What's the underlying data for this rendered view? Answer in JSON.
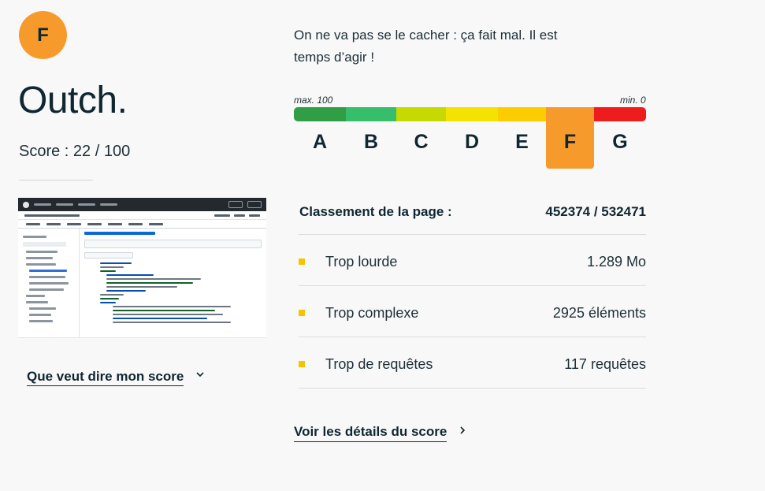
{
  "grade": {
    "letter": "F",
    "color": "#f79a2c"
  },
  "headline": "Outch.",
  "score": {
    "label": "Score : 22 / 100",
    "value": 22,
    "max": 100
  },
  "intro_text": "On ne va pas se le cacher : ça fait mal. Il est temps d’agir !",
  "scale": {
    "max_label": "max. 100",
    "min_label": "min. 0",
    "active": "F",
    "grades": [
      {
        "letter": "A",
        "color": "#2f9e44"
      },
      {
        "letter": "B",
        "color": "#37be6b"
      },
      {
        "letter": "C",
        "color": "#c6d900"
      },
      {
        "letter": "D",
        "color": "#f4e300"
      },
      {
        "letter": "E",
        "color": "#fdcc00"
      },
      {
        "letter": "F",
        "color": "#f79a2c"
      },
      {
        "letter": "G",
        "color": "#ee1c1c"
      }
    ]
  },
  "ranking": {
    "label": "Classement de la page :",
    "value": "452374 / 532471"
  },
  "metrics": [
    {
      "label": "Trop lourde",
      "value": "1.289 Mo",
      "bullet_color": "#f5c400"
    },
    {
      "label": "Trop complexe",
      "value": "2925 éléments",
      "bullet_color": "#f5c400"
    },
    {
      "label": "Trop de requêtes",
      "value": "117 requêtes",
      "bullet_color": "#f5c400"
    }
  ],
  "links": {
    "learn_more": "Que veut dire mon score",
    "details": "Voir les détails du score"
  },
  "icons": {
    "learn_more": "chevron-down-icon",
    "details": "chevron-right-icon"
  }
}
